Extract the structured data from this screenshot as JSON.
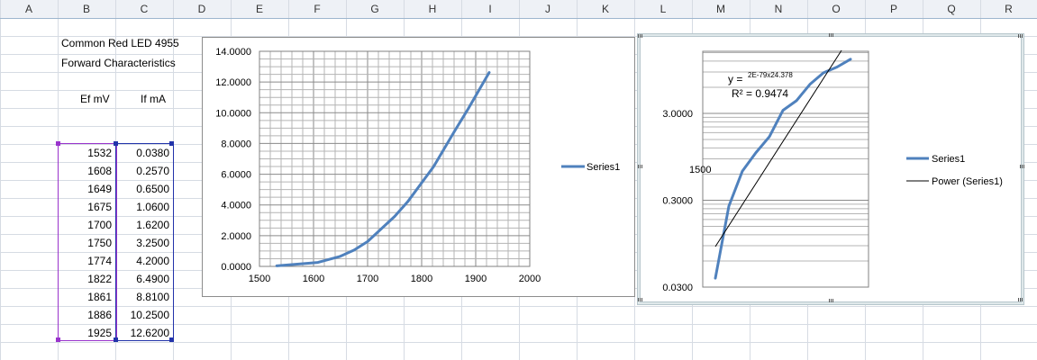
{
  "columns": [
    "A",
    "B",
    "C",
    "D",
    "E",
    "F",
    "G",
    "H",
    "I",
    "J",
    "K",
    "L",
    "M",
    "N",
    "O",
    "P",
    "Q",
    "R"
  ],
  "sheet": {
    "title1": "Common Red LED 4955",
    "title2": "Forward Characteristics",
    "header_ef": "Ef mV",
    "header_if": "If mA",
    "ef_values": [
      "1532",
      "1608",
      "1649",
      "1675",
      "1700",
      "1750",
      "1774",
      "1822",
      "1861",
      "1886",
      "1925"
    ],
    "if_values": [
      "0.0380",
      "0.2570",
      "0.6500",
      "1.0600",
      "1.6200",
      "3.2500",
      "4.2000",
      "6.4900",
      "8.8100",
      "10.2500",
      "12.6200"
    ]
  },
  "chart_data": [
    {
      "type": "line",
      "x": [
        1532,
        1608,
        1649,
        1675,
        1700,
        1750,
        1774,
        1822,
        1861,
        1886,
        1925
      ],
      "series": [
        {
          "name": "Series1",
          "values": [
            0.038,
            0.257,
            0.65,
            1.06,
            1.62,
            3.25,
            4.2,
            6.49,
            8.81,
            10.25,
            12.62
          ],
          "color": "#4F81BD"
        }
      ],
      "xlim": [
        1500,
        2000
      ],
      "ylim": [
        0,
        14
      ],
      "x_ticks": [
        "1500",
        "1600",
        "1700",
        "1800",
        "1900",
        "2000"
      ],
      "y_ticks": [
        "0.0000",
        "2.0000",
        "4.0000",
        "6.0000",
        "8.0000",
        "10.0000",
        "12.0000",
        "14.0000"
      ],
      "grid": true,
      "legend": "right",
      "legend_label": "Series1"
    },
    {
      "type": "line",
      "y_scale": "log",
      "series": [
        {
          "name": "Series1",
          "values": [
            0.038,
            0.257,
            0.65,
            1.06,
            1.62,
            3.25,
            4.2,
            6.49,
            8.81,
            10.25,
            12.62
          ],
          "color": "#4F81BD"
        }
      ],
      "trendline": {
        "name": "Power (Series1)",
        "color": "#000000"
      },
      "y_ticks": [
        "0.0300",
        "0.3000",
        "3.0000"
      ],
      "x_tick": "1500",
      "equation": "y = 2E-79x24.378",
      "equation_prefix": "y = ",
      "equation_sup": "2E-79x24.378",
      "r2": "R² = 0.9474",
      "grid": true,
      "legend": "right",
      "legend_series": "Series1",
      "legend_trend": "Power (Series1)"
    }
  ]
}
